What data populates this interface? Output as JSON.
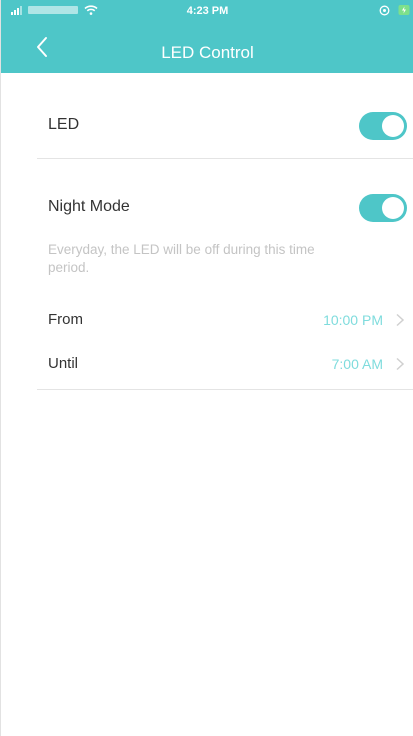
{
  "status_bar": {
    "time": "4:23 PM"
  },
  "nav": {
    "title": "LED Control",
    "back_icon": "chevron-left-icon"
  },
  "led": {
    "label": "LED",
    "enabled": true
  },
  "night_mode": {
    "label": "Night Mode",
    "enabled": true,
    "description": "Everyday, the LED will be off during this time period.",
    "from": {
      "label": "From",
      "value": "10:00 PM"
    },
    "until": {
      "label": "Until",
      "value": "7:00 AM"
    }
  },
  "colors": {
    "accent": "#4ec6c8",
    "value_text": "#7fdcdd",
    "description_text": "#c4c4c4"
  }
}
